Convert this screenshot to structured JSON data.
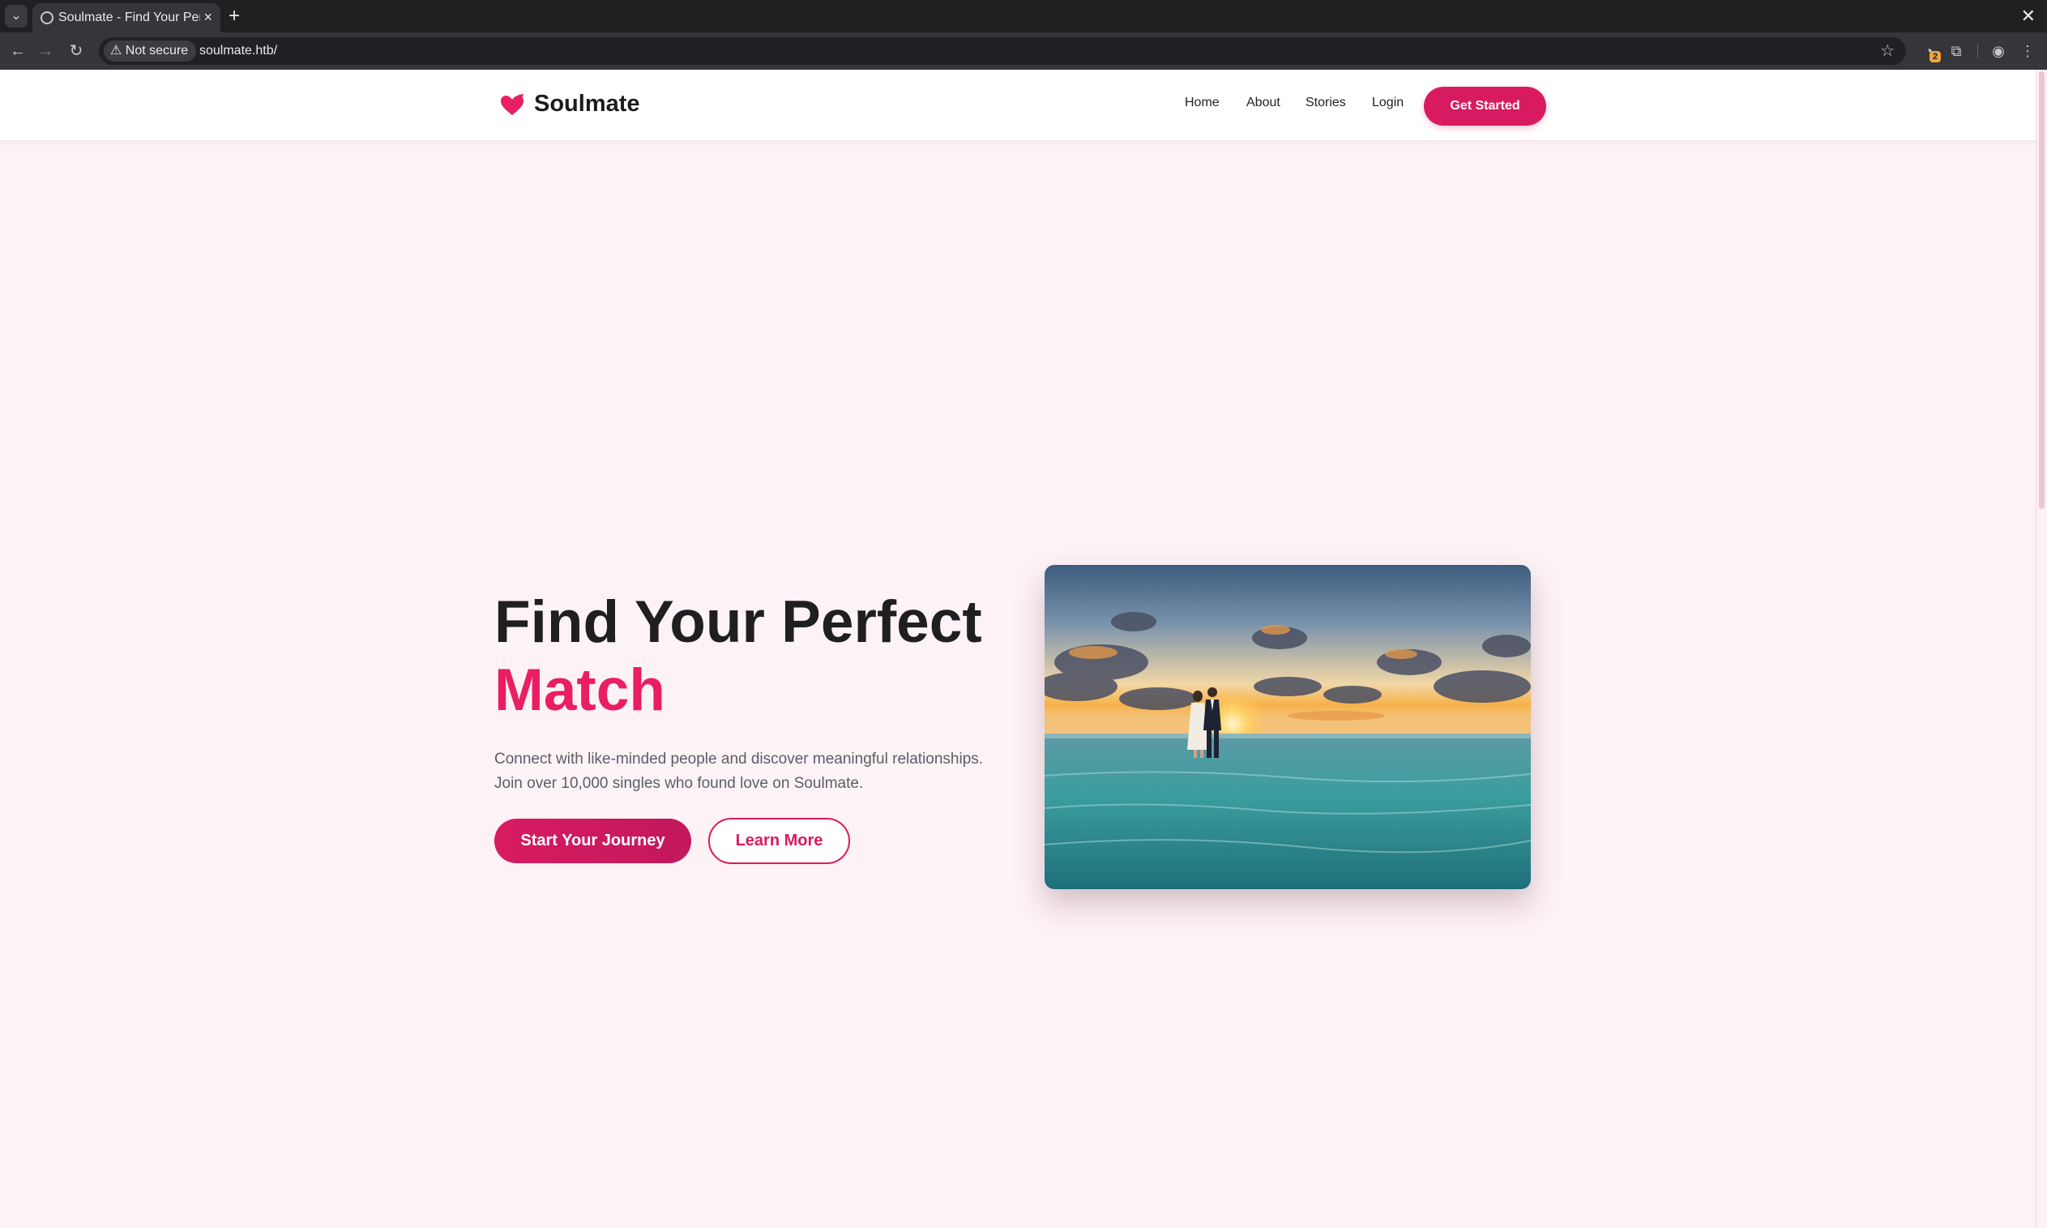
{
  "browser": {
    "tab_title": "Soulmate - Find Your Perfect Match",
    "tab_close": "×",
    "new_tab": "+",
    "window_close": "✕",
    "security_label": "Not secure",
    "url": "soulmate.htb/",
    "extension_badge": "2"
  },
  "site": {
    "brand": "Soulmate",
    "brand_color": "#e91e63",
    "nav": [
      {
        "label": "Home"
      },
      {
        "label": "About"
      },
      {
        "label": "Stories"
      },
      {
        "label": "Login"
      }
    ],
    "header_cta": "Get Started"
  },
  "hero": {
    "title_line1": "Find Your Perfect",
    "title_line2": "Match",
    "description_line1": "Connect with like-minded people and discover meaningful relationships.",
    "description_line2": "Join over 10,000 singles who found love on Soulmate.",
    "primary_button": "Start Your Journey",
    "secondary_button": "Learn More",
    "image": "couple walking on beach at sunset photo"
  }
}
